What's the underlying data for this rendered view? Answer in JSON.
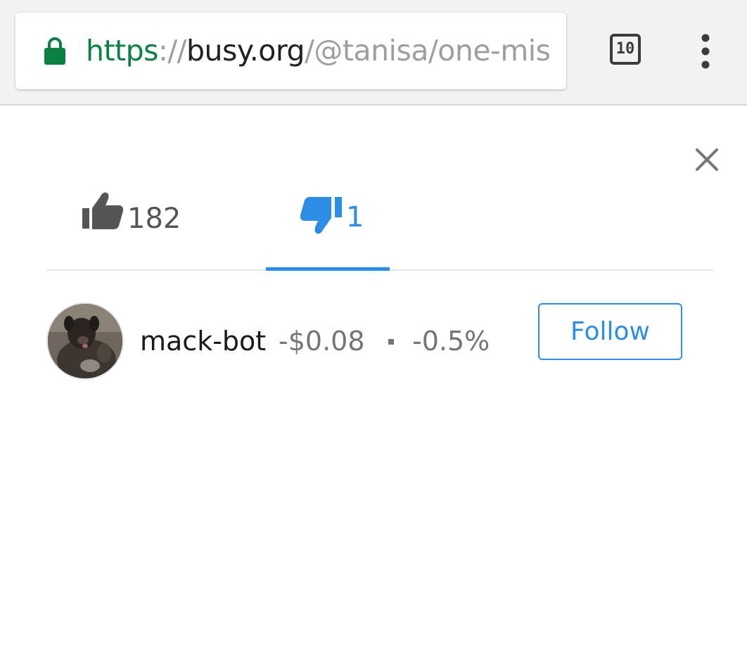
{
  "browser": {
    "url_scheme": "https",
    "url_separator": "://",
    "url_host": "busy.org",
    "url_path": "/@tanisa/one-mis",
    "tab_count": "10",
    "icons": {
      "lock": "lock-icon",
      "menu": "more-vert-icon"
    }
  },
  "dialog": {
    "close_icon": "close-icon",
    "tabs": [
      {
        "icon": "thumbs-up-icon",
        "count": "182",
        "active": false
      },
      {
        "icon": "thumbs-down-icon",
        "count": "1",
        "active": true
      }
    ],
    "voters": [
      {
        "name": "mack-bot",
        "amount": "-$0.08",
        "separator": "•",
        "percent": "-0.5%",
        "follow_label": "Follow"
      }
    ]
  },
  "colors": {
    "accent": "#2b8de4",
    "secure_green": "#0b8043",
    "muted_text": "#757575"
  }
}
